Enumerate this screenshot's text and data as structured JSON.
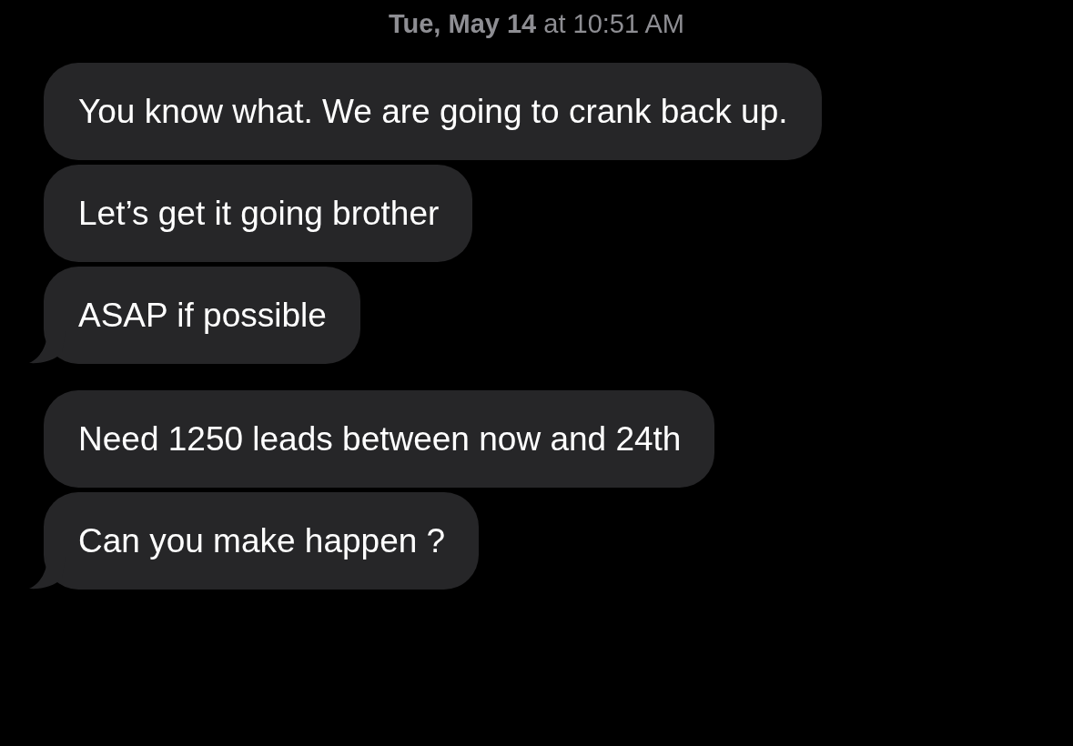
{
  "timestamp": "**Tue, May 14** at 10:51 AM",
  "messages": [
    {
      "text": "You know what. We are going to crank back up.",
      "tail": false
    },
    {
      "text": "Let’s get it going brother",
      "tail": false
    },
    {
      "text": "ASAP if possible",
      "tail": true
    },
    {
      "text": "Need 1250 leads between now and 24th",
      "tail": false
    },
    {
      "text": "Can you make happen ?",
      "tail": true
    }
  ]
}
